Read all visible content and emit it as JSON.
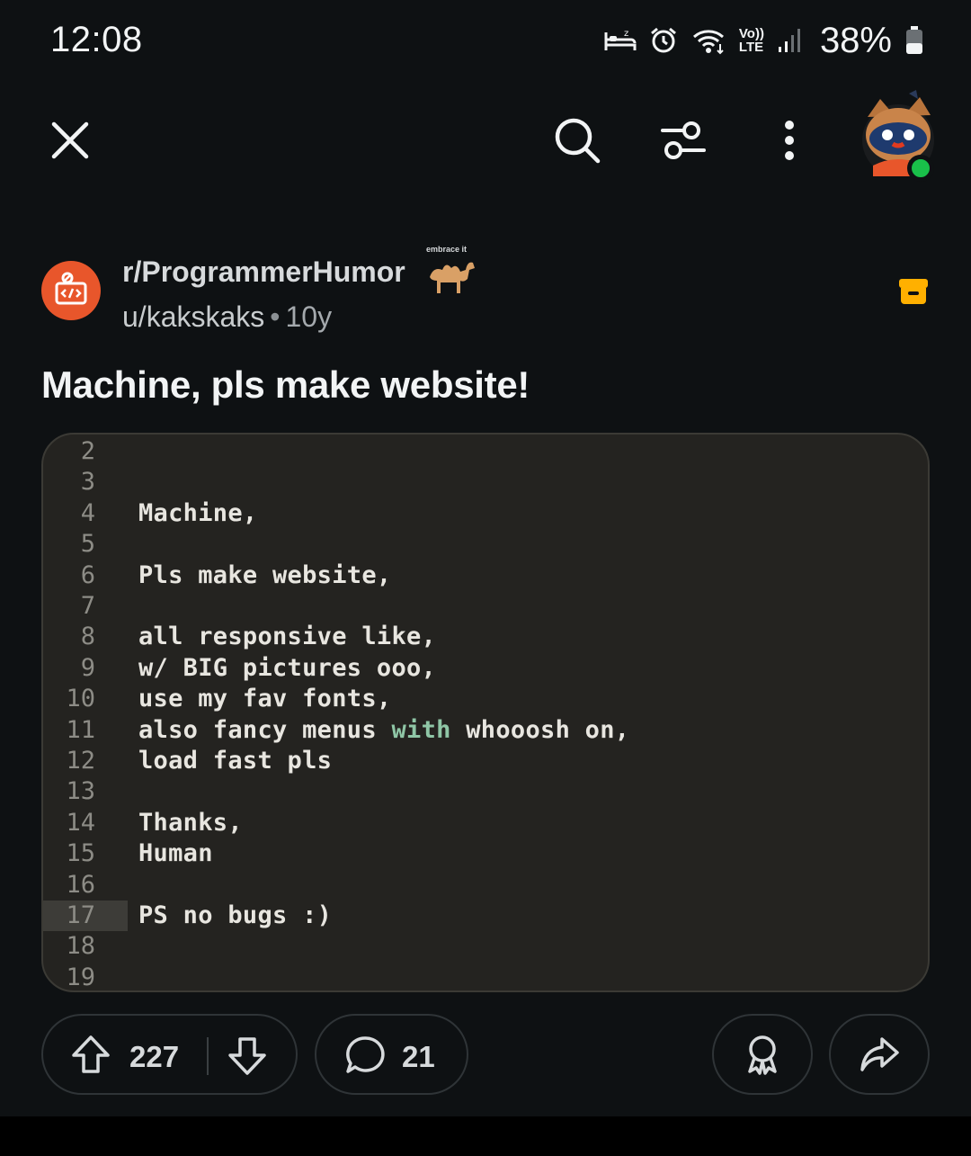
{
  "status_bar": {
    "time": "12:08",
    "battery": "38%",
    "net_type_top": "Vo))",
    "net_type_bottom": "LTE",
    "icons": [
      "sleep-icon",
      "alarm-icon",
      "wifi-icon",
      "volte-icon",
      "signal-icon",
      "battery-icon"
    ]
  },
  "top_bar": {
    "icons": [
      "close-icon",
      "search-icon",
      "filter-icon",
      "more-icon",
      "avatar"
    ]
  },
  "post": {
    "subreddit": "r/ProgrammerHumor",
    "flair_text": "embrace it",
    "author": "u/kakskaks",
    "separator": "•",
    "age": "10y",
    "title": "Machine, pls make website!"
  },
  "code_image": {
    "lines": [
      {
        "num": "2",
        "text": ""
      },
      {
        "num": "3",
        "text": ""
      },
      {
        "num": "4",
        "text": "Machine,"
      },
      {
        "num": "5",
        "text": ""
      },
      {
        "num": "6",
        "text": "Pls make website,"
      },
      {
        "num": "7",
        "text": ""
      },
      {
        "num": "8",
        "text": "all responsive like,"
      },
      {
        "num": "9",
        "text": "w/ BIG pictures ooo,"
      },
      {
        "num": "10",
        "text": "use my fav fonts,"
      },
      {
        "num": "11",
        "text_before": "also fancy menus ",
        "keyword": "with",
        "text_after": " whooosh on,"
      },
      {
        "num": "12",
        "text": "load fast pls"
      },
      {
        "num": "13",
        "text": ""
      },
      {
        "num": "14",
        "text": "Thanks,"
      },
      {
        "num": "15",
        "text": "Human"
      },
      {
        "num": "16",
        "text": ""
      },
      {
        "num": "17",
        "text": "PS no bugs :)",
        "current": true
      },
      {
        "num": "18",
        "text": ""
      },
      {
        "num": "19",
        "text": ""
      }
    ]
  },
  "actions": {
    "upvotes": "227",
    "comments": "21"
  },
  "colors": {
    "background": "#0e1113",
    "subreddit_icon": "#e8562b",
    "archive_icon": "#ffb000",
    "online": "#19c04a",
    "code_bg": "#242320",
    "keyword": "#8fc6a6"
  }
}
